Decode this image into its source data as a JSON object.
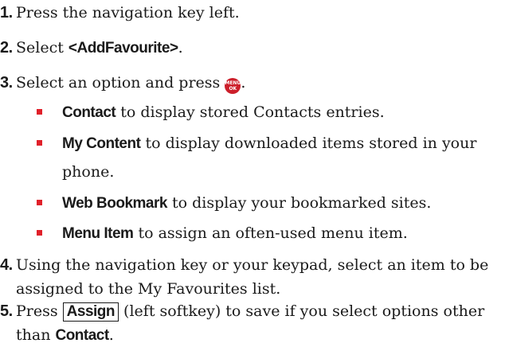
{
  "steps": [
    {
      "num": "1.",
      "text": "Press the navigation key left."
    },
    {
      "num": "2.",
      "prefix": "Select ",
      "bold": "<AddFavourite>",
      "suffix": "."
    },
    {
      "num": "3.",
      "text": "Select an option and press ",
      "icon": "menu-ok-key-icon",
      "icon_top": "MENU",
      "icon_bottom": "OK",
      "suffix": "."
    },
    {
      "num": "4.",
      "line1": "Using the navigation key or your keypad, select an item to be",
      "line2": "assigned to the My Favourites list."
    },
    {
      "num": "5.",
      "prefix": "Press ",
      "key": "Assign",
      "line1_rest": " (left softkey) to save if you select options other",
      "line2_prefix": "than ",
      "line2_bold": "Contact",
      "line2_suffix": "."
    }
  ],
  "options": [
    {
      "bold": "Contact",
      "text": " to display stored Contacts entries."
    },
    {
      "bold": "My Content",
      "text": " to display downloaded items stored in your",
      "text2": "phone."
    },
    {
      "bold": "Web Bookmark",
      "text": " to display your bookmarked sites."
    },
    {
      "bold": "Menu Item",
      "text": " to assign an often-used menu item."
    }
  ],
  "colors": {
    "bullet": "#e0202a",
    "menu_key": "#cc1f2b",
    "text": "#1a1a1a"
  }
}
